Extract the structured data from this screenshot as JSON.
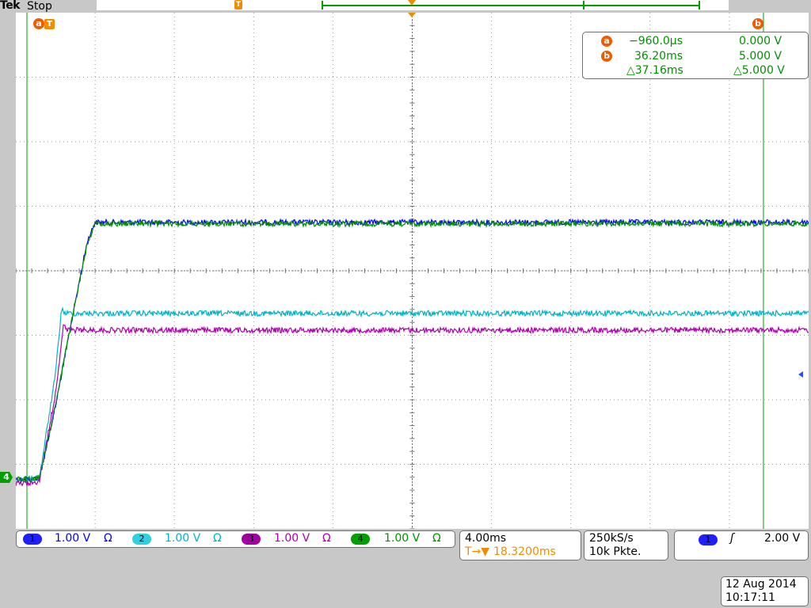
{
  "header": {
    "brand": "Tek",
    "run_state": "Stop"
  },
  "cursor_readout": {
    "badge_a": "a",
    "badge_b": "b",
    "cursor_a_time": "−960.0µs",
    "cursor_a_volt": "0.000 V",
    "cursor_b_time": "36.20ms",
    "cursor_b_volt": "5.000 V",
    "delta_time": "△37.16ms",
    "delta_volt": "△5.000 V"
  },
  "markers": {
    "cursor_a_label": "a",
    "cursor_b_label": "b",
    "trigger_label": "T",
    "ch4_ref": "4"
  },
  "channels": [
    {
      "number": "1",
      "scale": "1.00 V",
      "coupling": "Ω",
      "color": "#0000ff",
      "badge_color": "#2020ff"
    },
    {
      "number": "2",
      "scale": "1.00 V",
      "coupling": "Ω",
      "color": "#00b4c8",
      "badge_color": "#30d0e0"
    },
    {
      "number": "3",
      "scale": "1.00 V",
      "coupling": "Ω",
      "color": "#b000b0",
      "badge_color": "#a000a0"
    },
    {
      "number": "4",
      "scale": "1.00 V",
      "coupling": "Ω",
      "color": "#009000",
      "badge_color": "#00a000"
    }
  ],
  "timebase": {
    "scale": "4.00ms",
    "trigger_pos": "18.3200ms",
    "trigger_prefix": "T→▼"
  },
  "acquisition": {
    "rate": "250kS/s",
    "points": "10k Pkte."
  },
  "trigger": {
    "source": "1",
    "slope": "ʃ",
    "level": "2.00 V"
  },
  "datetime": {
    "date": "12 Aug 2014",
    "time": "10:17:11"
  },
  "chart_data": {
    "type": "line",
    "xlabel": "",
    "ylabel": "",
    "x_unit": "ms",
    "y_unit": "div",
    "x_scale_per_div": 4.0,
    "y_scale_per_div_volts": 1.0,
    "xlim": [
      -19.6,
      20.4
    ],
    "ylim": [
      -4,
      4
    ],
    "grid": true,
    "divisions": {
      "x": 10,
      "y": 8
    },
    "series": [
      {
        "name": "",
        "color": "#0000ff",
        "x": [
          -20,
          -18.8,
          -18.4,
          -17.6,
          -16.8,
          -16.0,
          -15.6,
          20.4
        ],
        "y": [
          -3.23,
          -3.23,
          -3.2,
          -2.1,
          -0.8,
          0.45,
          0.75,
          0.75
        ]
      },
      {
        "name": "",
        "color": "#00b4c8",
        "x": [
          -20,
          -18.8,
          -18.4,
          -17.6,
          -17.3,
          -17.1,
          20.4
        ],
        "y": [
          -3.23,
          -3.23,
          -3.2,
          -1.6,
          -0.6,
          -0.66,
          -0.66
        ]
      },
      {
        "name": "",
        "color": "#b000b0",
        "x": [
          -20,
          -18.8,
          -18.4,
          -17.6,
          -17.2,
          -17.0,
          20.4
        ],
        "y": [
          -3.3,
          -3.3,
          -3.25,
          -1.9,
          -0.85,
          -0.92,
          -0.92
        ]
      },
      {
        "name": "",
        "color": "#009000",
        "x": [
          -20,
          -18.8,
          -18.4,
          -17.6,
          -16.8,
          -16.0,
          -15.6,
          20.4
        ],
        "y": [
          -3.23,
          -3.23,
          -3.2,
          -2.1,
          -0.8,
          0.42,
          0.73,
          0.73
        ]
      }
    ],
    "cursors": {
      "a_x": -19.04,
      "b_x": 18.12
    },
    "trigger_x": 0
  }
}
